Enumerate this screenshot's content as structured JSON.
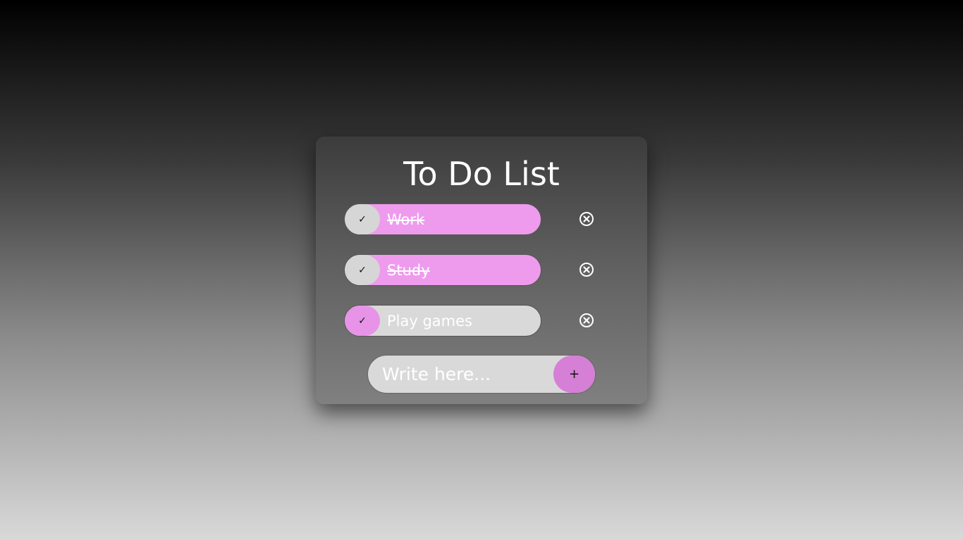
{
  "app": {
    "title": "To Do List"
  },
  "todos": [
    {
      "text": "Work",
      "done": true,
      "check_icon": "✓"
    },
    {
      "text": "Study",
      "done": true,
      "check_icon": "✓"
    },
    {
      "text": "Play games",
      "done": false,
      "check_icon": "✓"
    }
  ],
  "add_task": {
    "placeholder": "Write here...",
    "button_label": "+"
  },
  "colors": {
    "accent_pink": "#ee9bee",
    "add_button": "#d67fd6",
    "item_gray": "#d9d9d9",
    "text": "#ffffff"
  },
  "icons": {
    "check": "check-icon",
    "delete": "close-circle-icon",
    "add": "plus-icon"
  }
}
